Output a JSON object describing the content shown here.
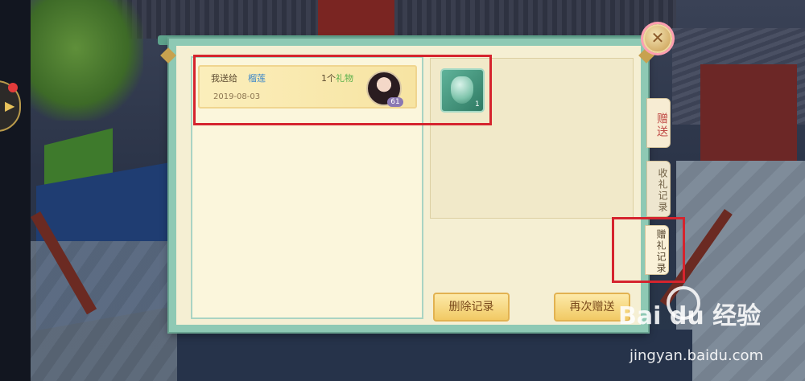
{
  "record": {
    "prefix": "我送给",
    "recipient": "榴莲",
    "gift_count": "1个",
    "gift_unit": "礼物",
    "date": "2019-08-03",
    "level": "61"
  },
  "gift_item": {
    "quantity": "1",
    "icon": "jade-pendant-icon"
  },
  "buttons": {
    "delete": "删除记录",
    "resend": "再次赠送",
    "close": "✕"
  },
  "tabs": {
    "gift": "赠送",
    "received": "收礼记录",
    "sent": "赠礼记录"
  },
  "watermark": {
    "logo": "Bai du 经验",
    "site": "jingyan.baidu.com"
  },
  "colors": {
    "panel_border": "#8ec9b4",
    "highlight": "#d5242e",
    "button": "#f1c964",
    "recipient_name": "#3f89c9",
    "gift_unit": "#58b04a"
  }
}
